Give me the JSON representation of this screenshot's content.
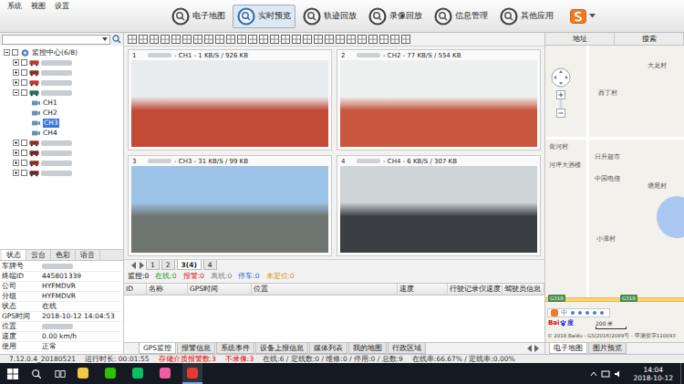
{
  "window": {
    "menu": [
      "系统",
      "视图",
      "设置"
    ]
  },
  "toolbar": [
    {
      "label": "电子地图",
      "selected": false
    },
    {
      "label": "实时预览",
      "selected": true
    },
    {
      "label": "轨迹回放",
      "selected": false
    },
    {
      "label": "录像回放",
      "selected": false
    },
    {
      "label": "信息管理",
      "selected": false
    },
    {
      "label": "其他应用",
      "selected": false
    }
  ],
  "tree": {
    "root": {
      "label": "监控中心(6/8)",
      "expanded": true,
      "checked": false
    },
    "vehicles": [
      {
        "expanded": false,
        "checked": false,
        "color": "#c0392b",
        "channels": []
      },
      {
        "expanded": false,
        "checked": false,
        "color": "#8e2f22",
        "channels": []
      },
      {
        "expanded": false,
        "checked": false,
        "color": "#c0392b",
        "channels": []
      },
      {
        "expanded": true,
        "checked": false,
        "color": "#2c6e5a",
        "channels": [
          {
            "label": "CH1",
            "selected": false
          },
          {
            "label": "CH2",
            "selected": false
          },
          {
            "label": "CH3",
            "selected": true
          },
          {
            "label": "CH4",
            "selected": false
          }
        ]
      },
      {
        "expanded": false,
        "checked": false,
        "color": "#8e2f22",
        "channels": []
      },
      {
        "expanded": false,
        "checked": false,
        "color": "#6b2a20",
        "channels": []
      },
      {
        "expanded": false,
        "checked": false,
        "color": "#8e2f22",
        "channels": []
      },
      {
        "expanded": false,
        "checked": false,
        "color": "#6b2a20",
        "channels": []
      }
    ]
  },
  "info_tabs": [
    {
      "label": "状态",
      "selected": true
    },
    {
      "label": "云台",
      "selected": false
    },
    {
      "label": "色彩",
      "selected": false
    },
    {
      "label": "语音",
      "selected": false
    }
  ],
  "info": [
    {
      "label": "车牌号",
      "value": "",
      "redacted": true
    },
    {
      "label": "终端ID",
      "value": "445801339",
      "redacted": false
    },
    {
      "label": "公司",
      "value": "HYFMDVR",
      "redacted": false
    },
    {
      "label": "分组",
      "value": "HYFMDVR",
      "redacted": false
    },
    {
      "label": "状态",
      "value": "在线",
      "redacted": false
    },
    {
      "label": "GPS时间",
      "value": "2018-10-12 14:04:53",
      "redacted": false
    },
    {
      "label": "位置",
      "value": "",
      "redacted": true
    },
    {
      "label": "速度",
      "value": "0.00 km/h",
      "redacted": false
    },
    {
      "label": "使用",
      "value": "正常",
      "redacted": false
    }
  ],
  "videos": [
    {
      "index": "1",
      "title": "- CH1 - 1 KB/S / 926 KB",
      "color_top": "#e9ecef",
      "color_bottom": "#c24a36"
    },
    {
      "index": "2",
      "title": "- CH2 - 77 KB/S / 554 KB",
      "color_top": "#eef0f0",
      "color_bottom": "#c9583f"
    },
    {
      "index": "3",
      "title": "- CH3 - 31 KB/S / 99 KB",
      "color_top": "#9dc3e6",
      "color_bottom": "#6e7570"
    },
    {
      "index": "4",
      "title": "- CH4 - 6 KB/S / 307 KB",
      "color_top": "#cfd4d6",
      "color_bottom": "#3b3f44"
    }
  ],
  "page_tabs": [
    {
      "label": "1",
      "selected": false
    },
    {
      "label": "2",
      "selected": false
    },
    {
      "label": "3(4)",
      "selected": true
    },
    {
      "label": "4",
      "selected": false
    }
  ],
  "counts": [
    {
      "text": "监控:0",
      "color": "#000000"
    },
    {
      "text": "在线:0",
      "color": "#1a9a1a"
    },
    {
      "text": "报警:0",
      "color": "#e02020"
    },
    {
      "text": "离线:0",
      "color": "#808080"
    },
    {
      "text": "停车:0",
      "color": "#1f5fd0"
    },
    {
      "text": "未定位:0",
      "color": "#e08a00"
    }
  ],
  "table": {
    "columns": [
      "ID",
      "名称",
      "GPS时间",
      "位置",
      "速度",
      "行驶记录仪速度",
      "驾驶员信息"
    ],
    "rows": []
  },
  "bottom_tabs": [
    {
      "label": "GPS监控",
      "selected": true
    },
    {
      "label": "报警信息",
      "selected": false
    },
    {
      "label": "系统事件",
      "selected": false
    },
    {
      "label": "设备上报信息",
      "selected": false
    },
    {
      "label": "媒体列表",
      "selected": false
    },
    {
      "label": "我的地图",
      "selected": false
    },
    {
      "label": "行政区域",
      "selected": false
    }
  ],
  "map": {
    "tabs": [
      "地址",
      "搜索"
    ],
    "labels": [
      "大龙村",
      "西丁村",
      "黄河村",
      "日升超市",
      "河坪大酒楼",
      "中国电信",
      "塘尾村",
      "小潭村"
    ],
    "shields": [
      "G318",
      "G318"
    ],
    "ime": "中",
    "logo": [
      "Bai",
      "度"
    ],
    "scale": "200 米",
    "copyright": "© 2018 Baidu - GS(2016)2089号 - 甲测资字110093",
    "bottom_tabs": [
      {
        "label": "电子地图",
        "selected": true
      },
      {
        "label": "图片预览",
        "selected": false
      }
    ]
  },
  "status_bar": [
    {
      "text": "7.12.0.4_20180521",
      "color": "#333333"
    },
    {
      "text": "运行时长: 00:01:55",
      "color": "#333333"
    },
    {
      "text": "存储介质报警数:3",
      "color": "#e00000"
    },
    {
      "text": "不录像:3",
      "color": "#e00000"
    },
    {
      "text": "在线:6 / 定线数:0 / 维修:0 / 停用:0 / 总数:9",
      "color": "#333333"
    },
    {
      "text": "在线率:66.67% / 定线率:0.00%",
      "color": "#333333"
    }
  ],
  "taskbar": {
    "apps": [
      {
        "color": "#f2c744",
        "active": false
      },
      {
        "color": "#2dc100",
        "active": false
      },
      {
        "color": "#07c160",
        "active": false
      },
      {
        "color": "#f25ca0",
        "active": false
      },
      {
        "color": "#e33b2e",
        "active": true
      }
    ],
    "time": "14:04",
    "date": "2018-10-12"
  }
}
